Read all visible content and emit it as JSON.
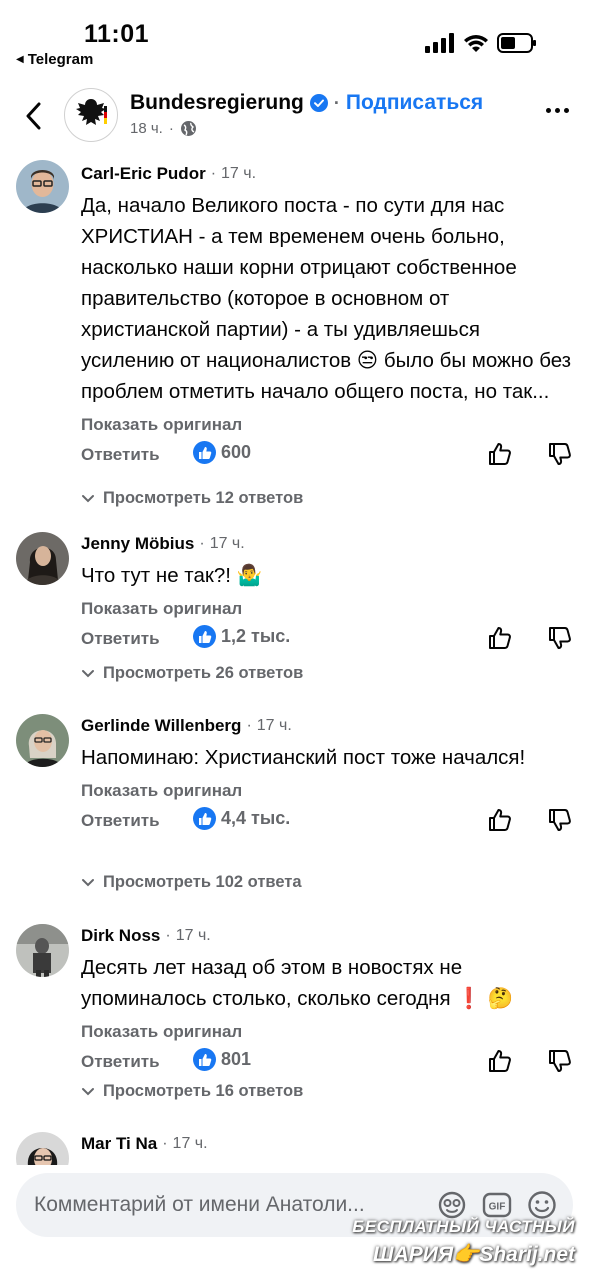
{
  "status_bar": {
    "time": "11:01",
    "back_app": "Telegram"
  },
  "header": {
    "page_name": "Bundesregierung",
    "subscribe": "Подписаться",
    "time": "18 ч.",
    "separator": "·"
  },
  "comments": [
    {
      "author": "Carl-Eric Pudor",
      "time": "17 ч.",
      "text": "Да, начало Великого поста - по сути для нас ХРИСТИАН - а тем временем очень больно, насколько наши корни отрицают собственное правительство (которое в основном от христианской партии) - а ты удивляешься усилению от националистов 😒 было бы можно без проблем отметить начало общего поста, но так...",
      "show_original": "Показать оригинал",
      "reply": "Ответить",
      "likes": "600",
      "view_replies": "Просмотреть 12 ответов"
    },
    {
      "author": "Jenny Möbius",
      "time": "17 ч.",
      "text": "Что тут не так?! 🤷‍♂️",
      "show_original": "Показать оригинал",
      "reply": "Ответить",
      "likes": "1,2 тыс.",
      "view_replies": "Просмотреть 26 ответов"
    },
    {
      "author": "Gerlinde Willenberg",
      "time": "17 ч.",
      "text": "Напоминаю: Христианский пост тоже начался!",
      "show_original": "Показать оригинал",
      "reply": "Ответить",
      "likes": "4,4 тыс.",
      "view_replies": "Просмотреть 102 ответа"
    },
    {
      "author": "Dirk Noss",
      "time": "17 ч.",
      "text": "Десять лет назад об этом в новостях не упоминалось столько, сколько сегодня ❗ 🤔",
      "show_original": "Показать оригинал",
      "reply": "Ответить",
      "likes": "801",
      "view_replies": "Просмотреть 16 ответов"
    },
    {
      "author": "Mar Ti Na",
      "time": "17 ч."
    }
  ],
  "composer": {
    "placeholder": "Комментарий от имени Анатоли..."
  },
  "watermark": {
    "line1": "БЕСПЛАТНЫЙ ЧАСТНЫЙ",
    "line2": "ШАРИЯ👉Sharij.net"
  },
  "colors": {
    "accent": "#1877f2",
    "secondary_text": "#65676b",
    "input_bg": "#f0f2f5"
  }
}
